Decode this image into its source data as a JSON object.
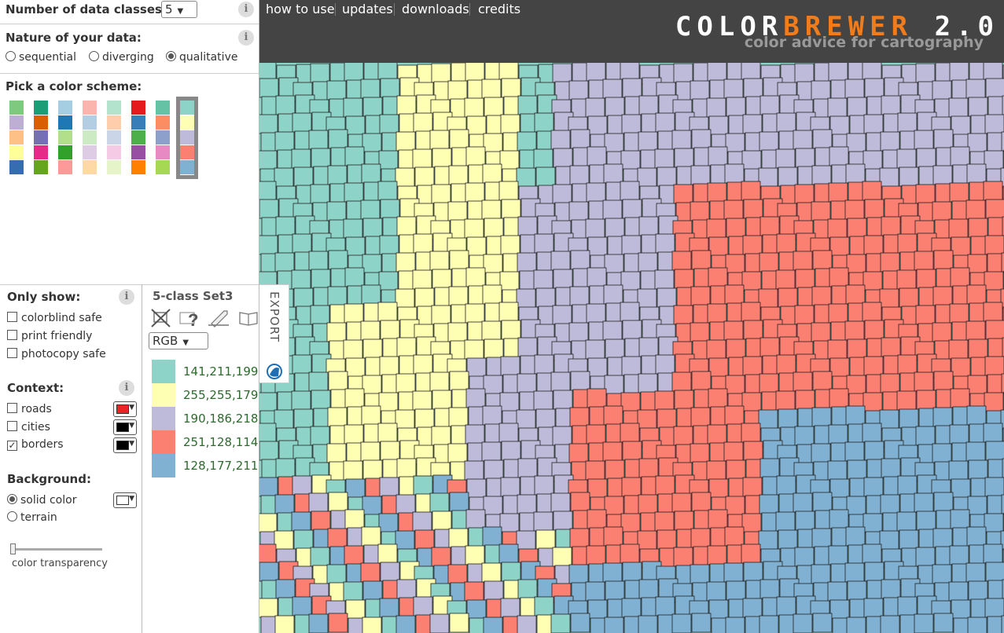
{
  "classes": {
    "label": "Number of data classes:",
    "value": "5"
  },
  "nature": {
    "label": "Nature of your data:",
    "options": [
      "sequential",
      "diverging",
      "qualitative"
    ],
    "selected": "qualitative"
  },
  "scheme_picker": {
    "label": "Pick a color scheme:",
    "schemes": [
      [
        "#7fc97f",
        "#beaed4",
        "#fdc086",
        "#ffff99",
        "#386cb0"
      ],
      [
        "#1b9e77",
        "#d95f02",
        "#7570b3",
        "#e7298a",
        "#66a61e"
      ],
      [
        "#a6cee3",
        "#1f78b4",
        "#b2df8a",
        "#33a02c",
        "#fb9a99"
      ],
      [
        "#fbb4ae",
        "#b3cde3",
        "#ccebc5",
        "#decbe4",
        "#fed9a6"
      ],
      [
        "#b3e2cd",
        "#fdcdac",
        "#cbd5e8",
        "#f4cae4",
        "#e6f5c9"
      ],
      [
        "#e41a1c",
        "#377eb8",
        "#4daf4a",
        "#984ea3",
        "#ff7f00"
      ],
      [
        "#66c2a5",
        "#fc8d62",
        "#8da0cb",
        "#e78ac3",
        "#a6d854"
      ],
      [
        "#8dd3c7",
        "#ffffb3",
        "#bebada",
        "#fb8072",
        "#80b1d3"
      ]
    ],
    "selected_index": 7
  },
  "only_show": {
    "label": "Only show:",
    "options": [
      {
        "label": "colorblind safe",
        "checked": false
      },
      {
        "label": "print friendly",
        "checked": false
      },
      {
        "label": "photocopy safe",
        "checked": false
      }
    ]
  },
  "context": {
    "label": "Context:",
    "options": [
      {
        "label": "roads",
        "checked": false,
        "color": "#e8262a"
      },
      {
        "label": "cities",
        "checked": false,
        "color": "#000000"
      },
      {
        "label": "borders",
        "checked": true,
        "color": "#000000"
      }
    ]
  },
  "background": {
    "label": "Background:",
    "options": [
      {
        "label": "solid color",
        "selected": true,
        "color": "#ffffff"
      },
      {
        "label": "terrain",
        "selected": false
      }
    ],
    "transparency_label": "color transparency",
    "transparency_value": 0
  },
  "legend": {
    "title": "5-class Set3",
    "format": "RGB",
    "icons": [
      "no-print-icon",
      "help-icon",
      "copy-icon",
      "book-icon"
    ],
    "classes": [
      {
        "color": "#8dd3c7",
        "rgb": "141,211,199"
      },
      {
        "color": "#ffffb3",
        "rgb": "255,255,179"
      },
      {
        "color": "#bebada",
        "rgb": "190,186,218"
      },
      {
        "color": "#fb8072",
        "rgb": "251,128,114"
      },
      {
        "color": "#80b1d3",
        "rgb": "128,177,211"
      }
    ]
  },
  "export_label": "EXPORT",
  "nav": [
    "how to use",
    "updates",
    "downloads",
    "credits"
  ],
  "brand": {
    "part1": "COLOR",
    "part2": "BREWER",
    "part3": " 2.0",
    "tagline": "color advice for cartography"
  }
}
